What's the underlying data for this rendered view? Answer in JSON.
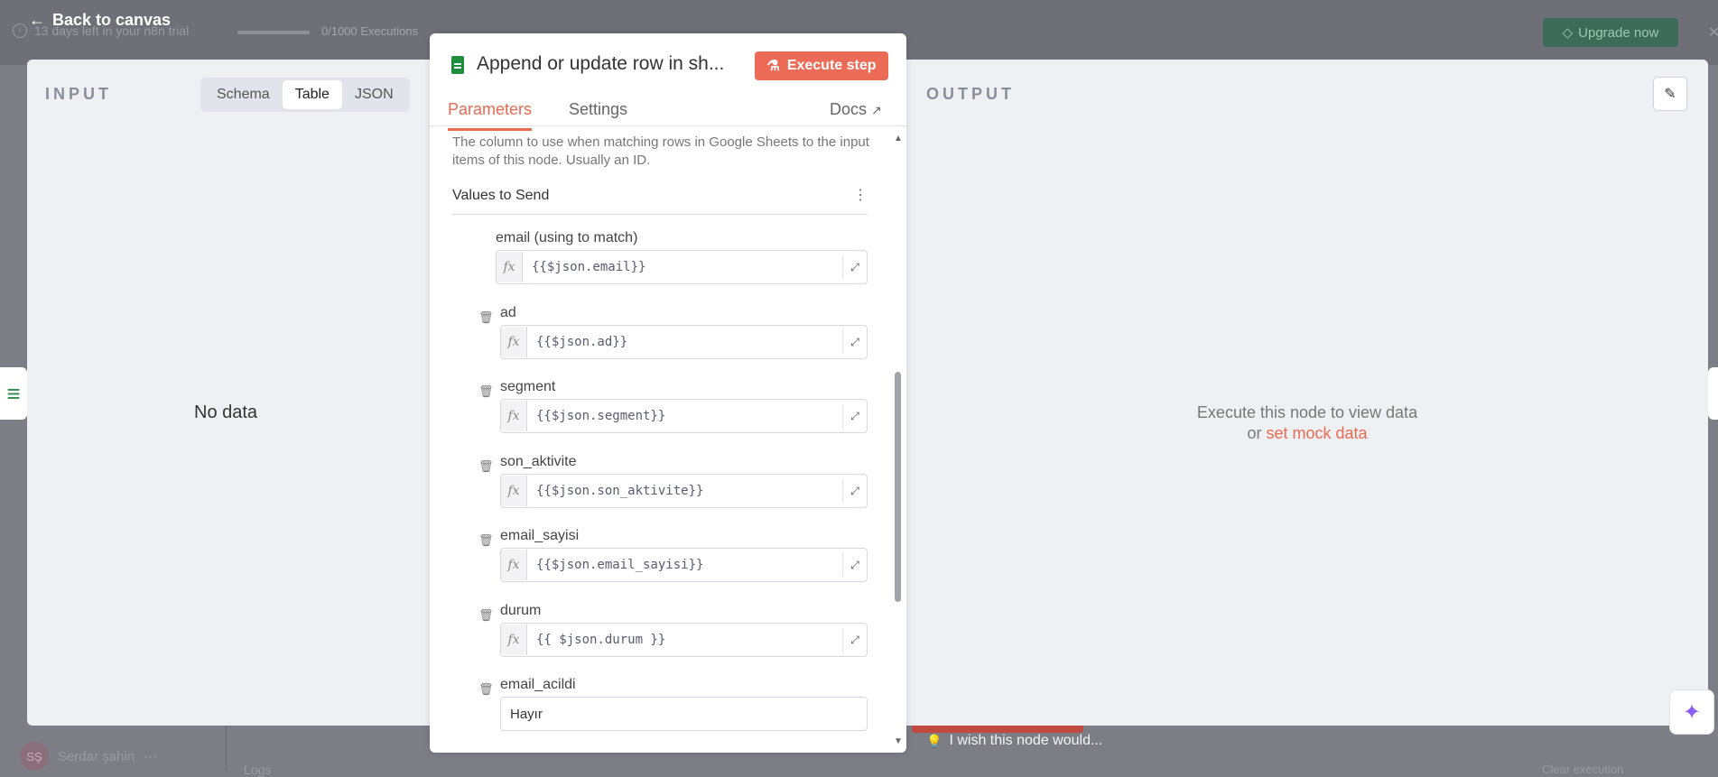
{
  "background": {
    "trial_text": "13 days left in your n8n trial",
    "executions": "0/1000 Executions",
    "upgrade_label": "Upgrade now",
    "user_initials": "SŞ",
    "user_name": "Serdar şahin",
    "logs_label": "Logs",
    "clear_label": "Clear execution",
    "wish_text": "I wish this node would..."
  },
  "back_label": "Back to canvas",
  "input": {
    "title": "INPUT",
    "modes": [
      "Schema",
      "Table",
      "JSON"
    ],
    "active_mode": "Table",
    "empty_text": "No data"
  },
  "output": {
    "title": "OUTPUT",
    "message_line1": "Execute this node to view data",
    "message_or": "or",
    "mock_link": "set mock data"
  },
  "node": {
    "title": "Append or update row in sh...",
    "execute_label": "Execute step",
    "tabs": {
      "parameters": "Parameters",
      "settings": "Settings",
      "docs": "Docs"
    },
    "hint": "The column to use when matching rows in Google Sheets to the input items of this node. Usually an ID.",
    "section_title": "Values to Send",
    "fields": [
      {
        "label": "email (using to match)",
        "value": "{{$json.email}}"
      },
      {
        "label": "ad",
        "value": "{{$json.ad}}"
      },
      {
        "label": "segment",
        "value": "{{$json.segment}}"
      },
      {
        "label": "son_aktivite",
        "value": "{{$json.son_aktivite}}"
      },
      {
        "label": "email_sayisi",
        "value": "{{$json.email_sayisi}}"
      },
      {
        "label": "durum",
        "value": "{{ $json.durum }}"
      },
      {
        "label": "email_acildi",
        "value": "Hayır"
      }
    ],
    "fx_label": "fx"
  },
  "colors": {
    "accent": "#ea6a52",
    "execute_button": "#ec6b57",
    "sheets_green": "#1e8e3e"
  },
  "icons": [
    "arrow-left-icon",
    "google-sheets-icon",
    "flask-icon",
    "external-link-icon",
    "trash-icon",
    "expand-icon",
    "pencil-icon",
    "sparkle-icon",
    "lightbulb-icon",
    "info-icon",
    "diamond-icon",
    "kebab-menu-icon"
  ]
}
